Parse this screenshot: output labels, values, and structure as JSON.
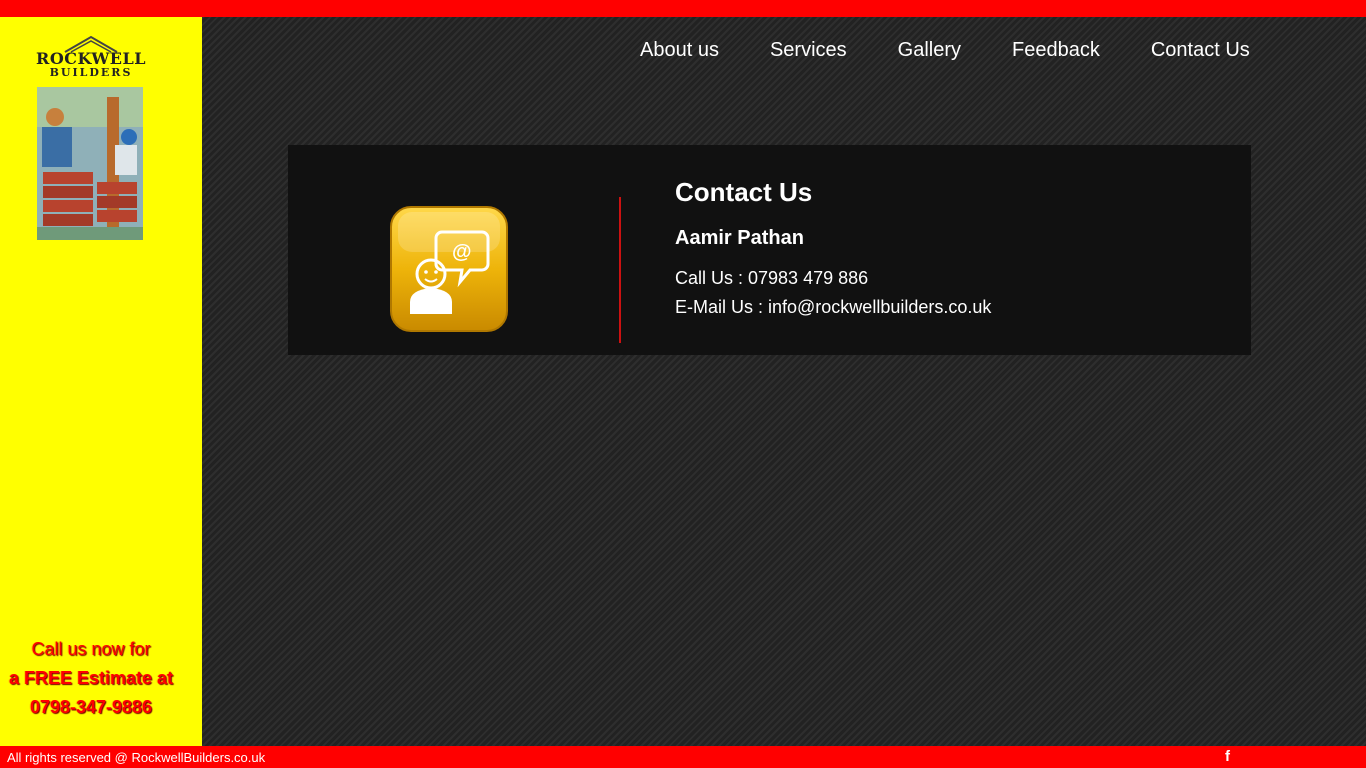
{
  "logo": {
    "line1": "ROCKWELL",
    "line2": "BUILDERS",
    "image_icon": "builders-artwork-icon",
    "roof_icon": "roof-icon"
  },
  "nav": {
    "items": [
      {
        "label": "About us"
      },
      {
        "label": "Services"
      },
      {
        "label": "Gallery"
      },
      {
        "label": "Feedback"
      },
      {
        "label": "Contact Us"
      }
    ]
  },
  "sidebar": {
    "cta_line1": "Call us now for",
    "cta_line2": "a FREE Estimate at",
    "cta_line3": "0798-347-9886"
  },
  "contact": {
    "icon": "contact-person-email-icon",
    "title": "Contact Us",
    "name": "Aamir Pathan",
    "phone_line": "Call Us : 07983 479 886",
    "email_line": "E-Mail Us : info@rockwellbuilders.co.uk"
  },
  "footer": {
    "copyright": "All rights reserved @ RockwellBuilders.co.uk",
    "facebook_label": "f",
    "facebook_icon": "facebook-icon"
  },
  "colors": {
    "top_bar": "#ff0000",
    "sidebar": "#ffff00",
    "background": "#262626",
    "panel": "#111111",
    "accent": "#cc1111",
    "icon_gold": "#e8a800"
  }
}
